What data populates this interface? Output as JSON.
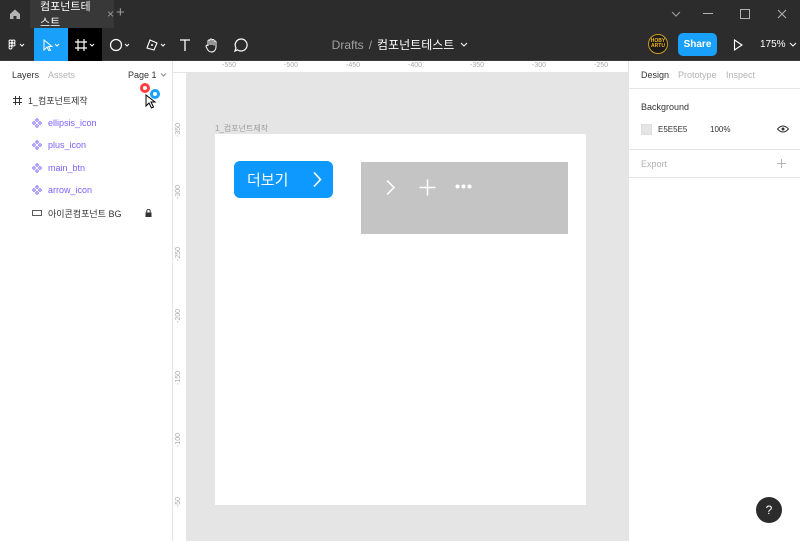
{
  "titlebar": {
    "tab_title": "컴포넌트테스트",
    "tab_close": "×",
    "new_tab": "+"
  },
  "toolbar": {
    "breadcrumb_parent": "Drafts",
    "breadcrumb_separator": "/",
    "file_name": "컴포넌트테스트",
    "share_label": "Share",
    "zoom_level": "175%",
    "avatar_text": "HOBY ARTU"
  },
  "left_panel": {
    "tabs": {
      "layers": "Layers",
      "assets": "Assets"
    },
    "page_selector": "Page 1",
    "frame_layer": "1_컴포넌트제작",
    "layers": [
      {
        "label": "ellipsis_icon",
        "kind": "component"
      },
      {
        "label": "plus_icon",
        "kind": "component"
      },
      {
        "label": "main_btn",
        "kind": "component"
      },
      {
        "label": "arrow_icon",
        "kind": "component"
      },
      {
        "label": "아이콘컴포넌트 BG",
        "kind": "rectangle",
        "locked": true
      }
    ]
  },
  "rulers": {
    "horizontal": [
      "-550",
      "-500",
      "-450",
      "-400",
      "-350",
      "-300",
      "-250"
    ],
    "vertical": [
      "-350",
      "-300",
      "-250",
      "-200",
      "-150",
      "-100",
      "-50"
    ]
  },
  "canvas": {
    "frame_name": "1_컴포넌트제작",
    "main_button_label": "더보기",
    "colors": {
      "button": "#0D99FF",
      "icon_bg": "#C4C4C4",
      "canvas_bg": "#E5E5E5"
    }
  },
  "right_panel": {
    "tabs": {
      "design": "Design",
      "prototype": "Prototype",
      "inspect": "Inspect"
    },
    "background_title": "Background",
    "background_hex": "E5E5E5",
    "background_opacity": "100%",
    "export_title": "Export"
  },
  "help_label": "?"
}
